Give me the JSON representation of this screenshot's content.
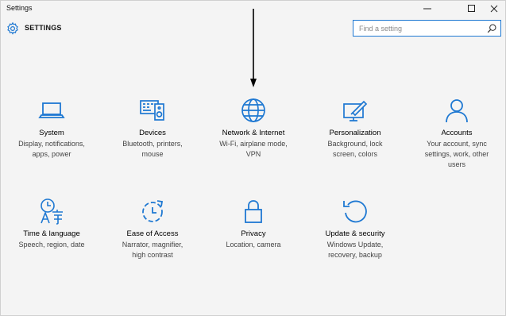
{
  "window": {
    "title": "Settings",
    "minimize": "—",
    "maximize": "☐",
    "close": "✕"
  },
  "header": {
    "title": "SETTINGS",
    "search_placeholder": "Find a setting"
  },
  "colors": {
    "accent": "#1e78d2",
    "background": "#f4f4f4"
  },
  "tiles": [
    {
      "icon": "laptop-icon",
      "title": "System",
      "desc": "Display, notifications, apps, power"
    },
    {
      "icon": "devices-icon",
      "title": "Devices",
      "desc": "Bluetooth, printers, mouse"
    },
    {
      "icon": "globe-icon",
      "title": "Network & Internet",
      "desc": "Wi-Fi, airplane mode, VPN"
    },
    {
      "icon": "personalization-icon",
      "title": "Personalization",
      "desc": "Background, lock screen, colors"
    },
    {
      "icon": "account-icon",
      "title": "Accounts",
      "desc": "Your account, sync settings, work, other users"
    },
    {
      "icon": "time-language-icon",
      "title": "Time & language",
      "desc": "Speech, region, date"
    },
    {
      "icon": "ease-of-access-icon",
      "title": "Ease of Access",
      "desc": "Narrator, magnifier, high contrast"
    },
    {
      "icon": "lock-icon",
      "title": "Privacy",
      "desc": "Location, camera"
    },
    {
      "icon": "refresh-icon",
      "title": "Update & security",
      "desc": "Windows Update, recovery, backup"
    }
  ]
}
